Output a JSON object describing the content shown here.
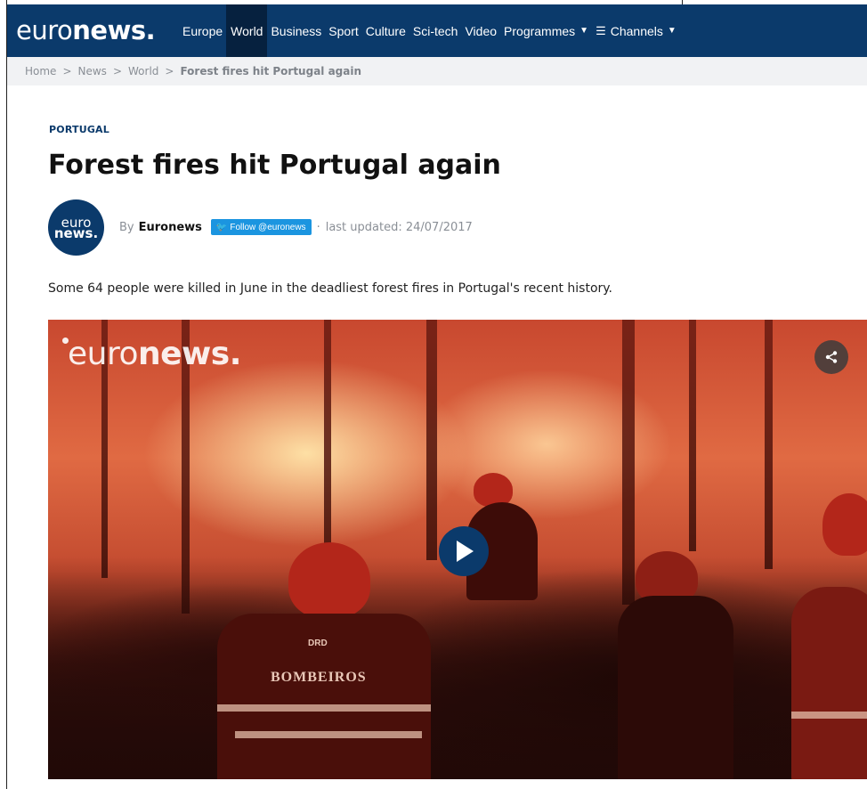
{
  "site": {
    "logo_light": "euro",
    "logo_bold": "news."
  },
  "nav": {
    "items": [
      {
        "label": "Europe",
        "active": false
      },
      {
        "label": "World",
        "active": true
      },
      {
        "label": "Business",
        "active": false
      },
      {
        "label": "Sport",
        "active": false
      },
      {
        "label": "Culture",
        "active": false
      },
      {
        "label": "Sci-tech",
        "active": false
      },
      {
        "label": "Video",
        "active": false
      },
      {
        "label": "Programmes",
        "active": false
      },
      {
        "label": "Channels",
        "active": false
      }
    ]
  },
  "breadcrumb": {
    "home": "Home",
    "news": "News",
    "world": "World",
    "current": "Forest fires hit Portugal again",
    "separator": ">"
  },
  "article": {
    "kicker": "PORTUGAL",
    "headline": "Forest fires hit Portugal again",
    "avatar_line1": "euro",
    "avatar_line2": "news.",
    "by_prefix": "By",
    "author": "Euronews",
    "follow_label": "Follow @euronews",
    "dot": "·",
    "updated": "last updated: 24/07/2017",
    "summary": "Some 64 people were killed in June in the deadliest forest fires in Portugal's recent history."
  },
  "video": {
    "watermark_light": "euro",
    "watermark_bold": "news.",
    "jacket_text": "BOMBEIROS",
    "jacket_small": "DRD"
  },
  "colors": {
    "brand": "#0b3a6b",
    "nav_active": "#06213f",
    "breadcrumb_bg": "#f1f2f4",
    "twitter": "#1b95e0"
  },
  "icons": [
    "caret-down-icon",
    "menu-icon",
    "twitter-bird-icon",
    "share-icon",
    "play-icon"
  ]
}
